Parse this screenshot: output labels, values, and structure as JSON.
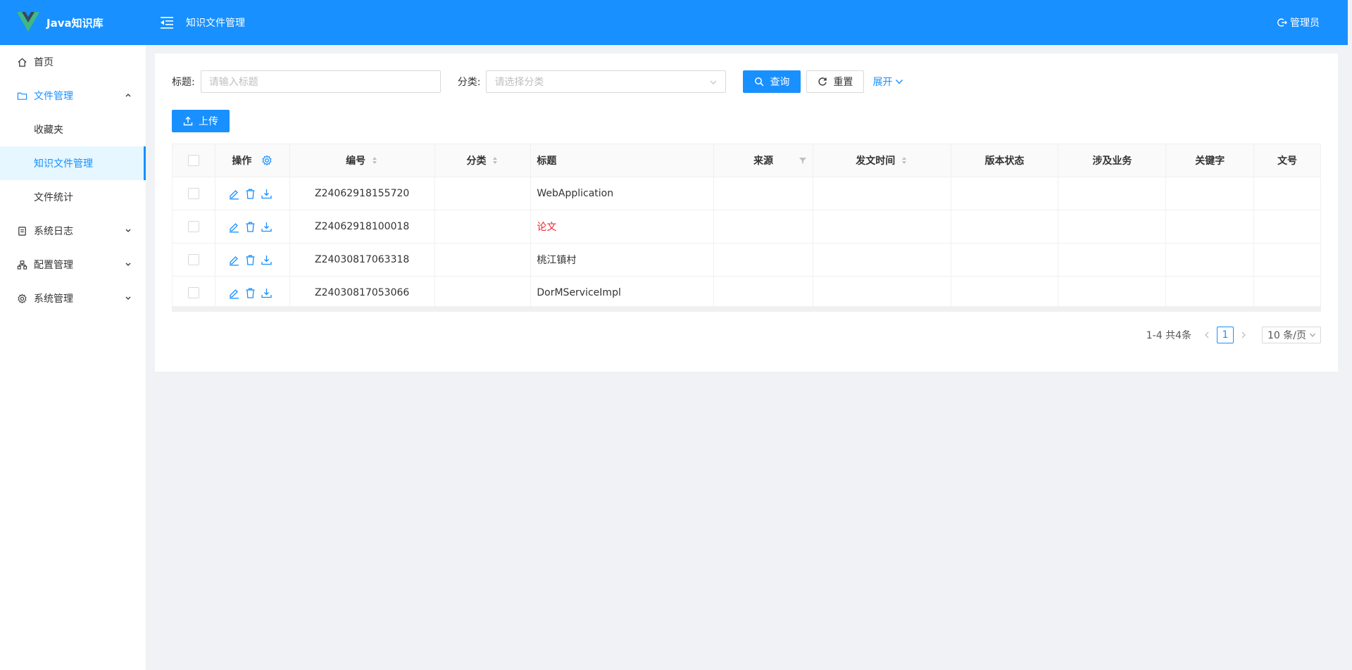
{
  "header": {
    "app_name": "Java知识库",
    "page_title": "知识文件管理",
    "user_label": "管理员"
  },
  "sidebar": {
    "items": [
      {
        "label": "首页",
        "icon": "home-icon"
      },
      {
        "label": "文件管理",
        "icon": "folder-icon",
        "expanded": true
      },
      {
        "label": "收藏夹"
      },
      {
        "label": "知识文件管理",
        "selected": true
      },
      {
        "label": "文件统计"
      },
      {
        "label": "系统日志",
        "icon": "log-icon"
      },
      {
        "label": "配置管理",
        "icon": "cluster-icon"
      },
      {
        "label": "系统管理",
        "icon": "gear-icon"
      }
    ]
  },
  "search": {
    "title_label": "标题:",
    "title_placeholder": "请输入标题",
    "category_label": "分类:",
    "category_placeholder": "请选择分类",
    "query_button": "查询",
    "reset_button": "重置",
    "expand_link": "展开"
  },
  "toolbar": {
    "upload_button": "上传"
  },
  "table": {
    "columns": {
      "op": "操作",
      "no": "编号",
      "category": "分类",
      "title": "标题",
      "source": "来源",
      "time": "发文时间",
      "version": "版本状态",
      "business": "涉及业务",
      "keyword": "关键字",
      "doc_no": "文号"
    },
    "rows": [
      {
        "no": "Z24062918155720",
        "title": "WebApplication"
      },
      {
        "no": "Z24062918100018",
        "title": "论文",
        "title_color": "#f5222d"
      },
      {
        "no": "Z24030817063318",
        "title": "桃江镇村"
      },
      {
        "no": "Z24030817053066",
        "title": "DorMServiceImpl"
      }
    ]
  },
  "pagination": {
    "summary": "1-4 共4条",
    "current_page": "1",
    "page_size": "10 条/页"
  },
  "colors": {
    "primary": "#1890ff",
    "danger": "#f5222d"
  }
}
